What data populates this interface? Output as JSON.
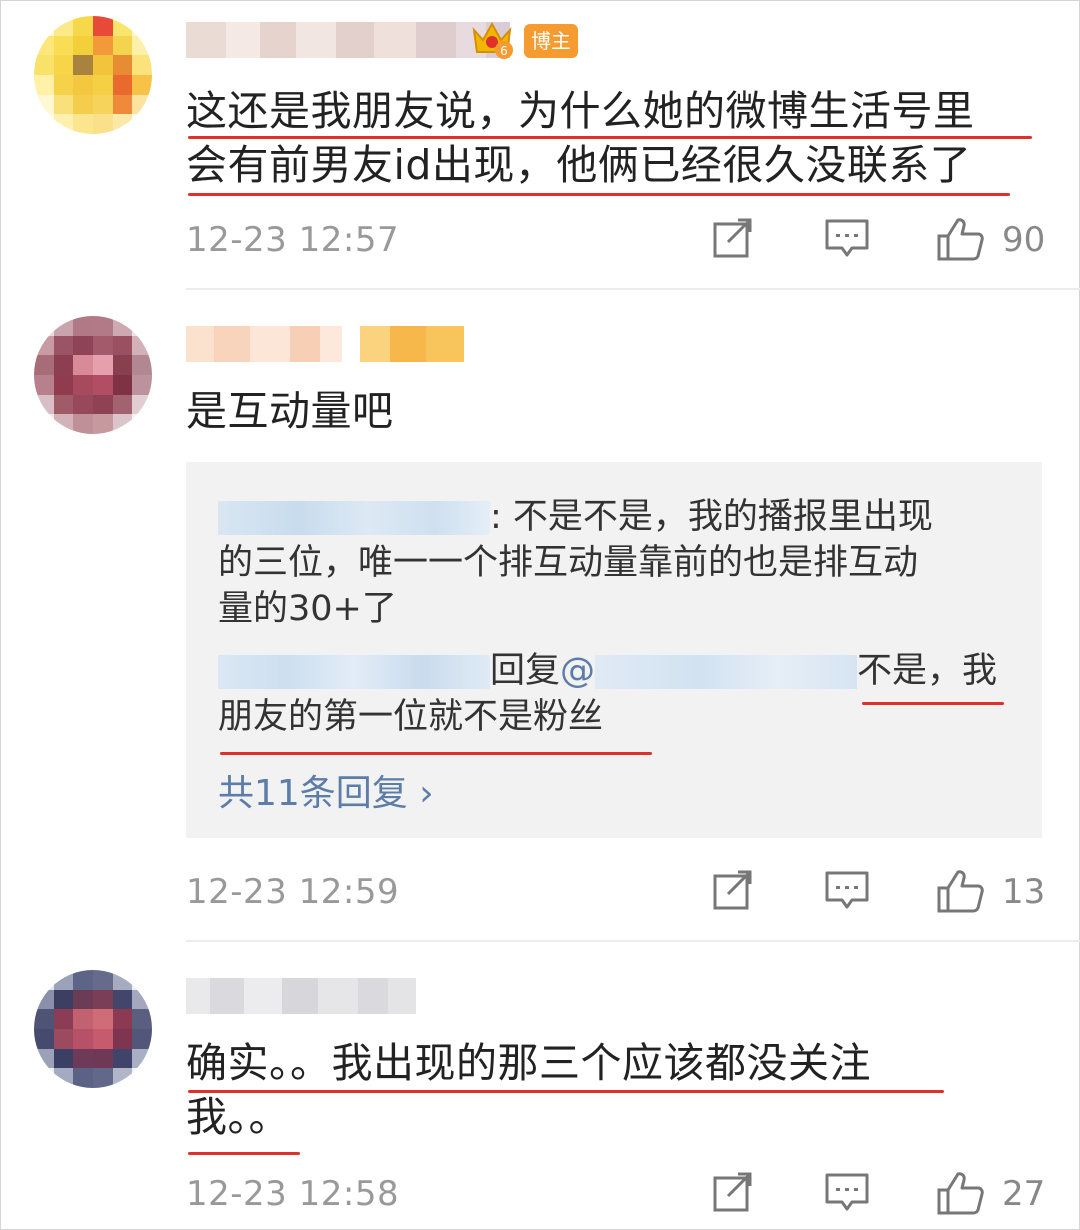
{
  "comments": [
    {
      "badge": "博主",
      "text_line1": "这还是我朋友说，为什么她的微博生活号里",
      "text_line2": "会有前男友id出现，他俩已经很久没联系了",
      "time": "12-23 12:57",
      "likes": "90"
    },
    {
      "text_line1": "是互动量吧",
      "time": "12-23 12:59",
      "likes": "13",
      "reply": {
        "r1_line1": ": 不是不是，我的播报里出现",
        "r1_line2": "的三位，唯一一个排互动量靠前的也是排互动",
        "r1_line3": "量的30+了",
        "r2_mid": "回复",
        "r2_at": "@",
        "r2_tail": "不是，我",
        "r2_line2": "朋友的第一位就不是粉丝",
        "more": "共11条回复 ›"
      }
    },
    {
      "text_line1": "确实。。我出现的那三个应该都没关注",
      "text_line2": "我。。",
      "time": "12-23 12:58",
      "likes": "27"
    }
  ],
  "icons": {
    "share": "share-icon",
    "comment": "comment-icon",
    "like": "like-icon",
    "crown": "crown-icon"
  },
  "colors": {
    "underline": "#e0302a",
    "badge": "#f59b2f",
    "link": "#5b7da8",
    "meta": "#999999"
  }
}
